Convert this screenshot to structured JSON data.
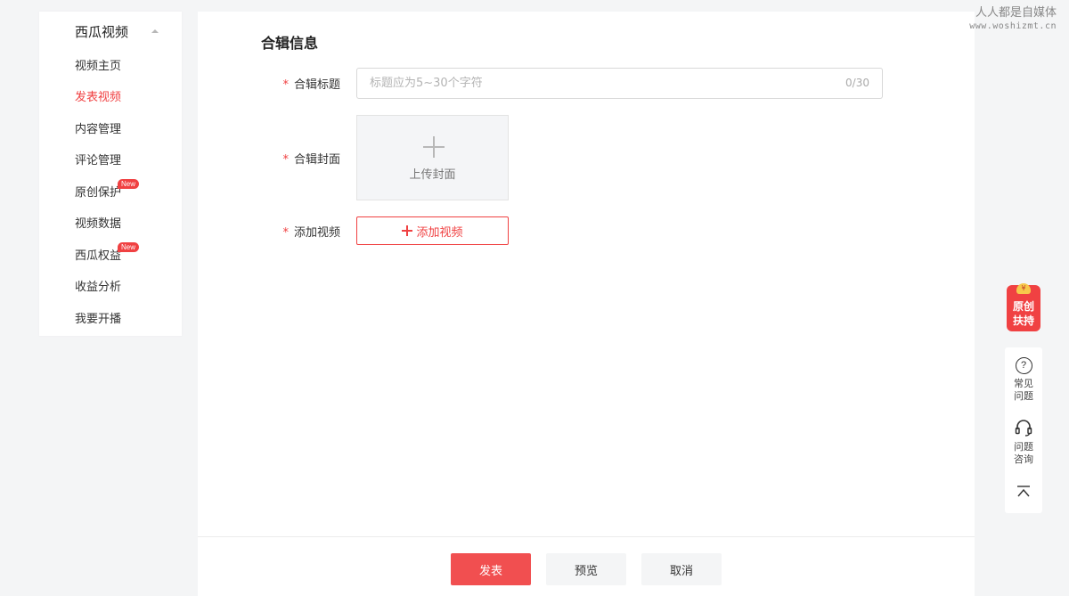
{
  "sidebar": {
    "title": "西瓜视频",
    "items": [
      {
        "label": "视频主页"
      },
      {
        "label": "发表视频"
      },
      {
        "label": "内容管理"
      },
      {
        "label": "评论管理"
      },
      {
        "label": "原创保护",
        "badge": "New"
      },
      {
        "label": "视频数据"
      },
      {
        "label": "西瓜权益",
        "badge": "New"
      },
      {
        "label": "收益分析"
      },
      {
        "label": "我要开播"
      }
    ],
    "active_item": "发表视频",
    "accent_color": "#f04142"
  },
  "form": {
    "section_title": "合辑信息",
    "required_mark": "*",
    "title_field": {
      "label": "合辑标题",
      "placeholder": "标题应为5~30个字符",
      "value": "",
      "counter": "0/30"
    },
    "cover_field": {
      "label": "合辑封面",
      "upload_text": "上传封面"
    },
    "video_field": {
      "label": "添加视频",
      "button_text": "添加视频"
    }
  },
  "footer": {
    "publish": "发表",
    "preview": "预览",
    "cancel": "取消"
  },
  "watermark": {
    "name": "人人都是自媒体",
    "url": "www.woshizmt.cn"
  },
  "floating": {
    "promo_line1": "原创",
    "promo_line2": "扶持",
    "promo_coin": "¥",
    "faq_line1": "常见",
    "faq_line2": "问题",
    "consult_line1": "问题",
    "consult_line2": "咨询"
  }
}
